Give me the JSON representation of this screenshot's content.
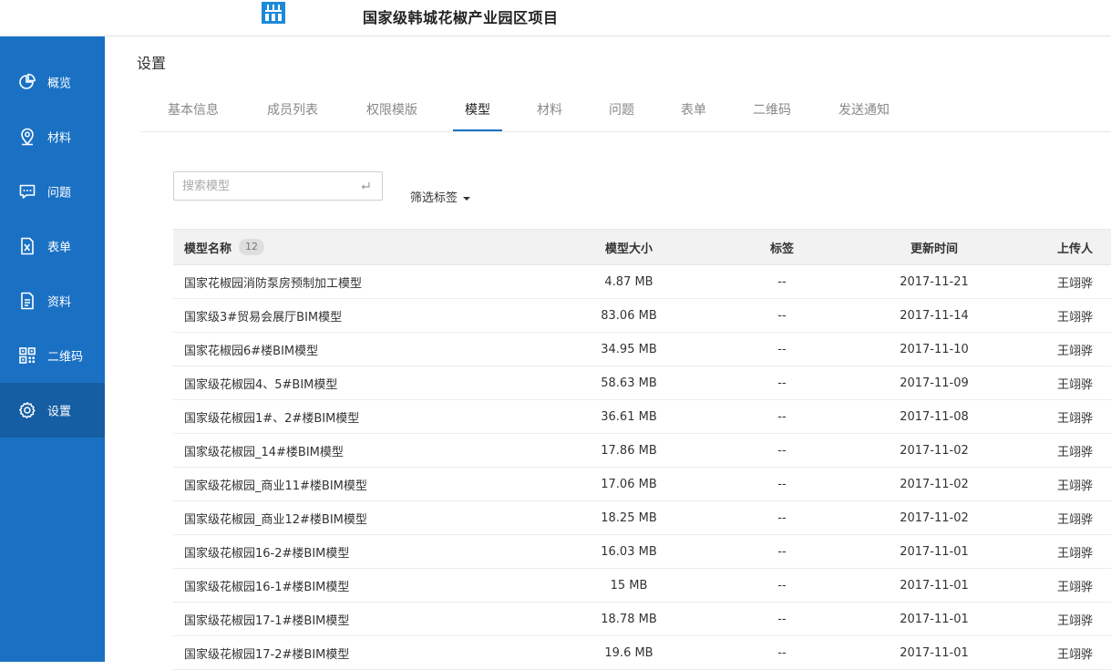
{
  "header": {
    "logo": "company-logo",
    "project_title": "国家级韩城花椒产业园区项目"
  },
  "sidebar": {
    "items": [
      {
        "label": "概览",
        "icon": "pie-chart-icon"
      },
      {
        "label": "材料",
        "icon": "location-pin-icon"
      },
      {
        "label": "问题",
        "icon": "chat-bubble-icon"
      },
      {
        "label": "表单",
        "icon": "excel-file-icon"
      },
      {
        "label": "资料",
        "icon": "document-icon"
      },
      {
        "label": "二维码",
        "icon": "qr-code-icon"
      },
      {
        "label": "设置",
        "icon": "gear-icon",
        "active": true
      }
    ],
    "colors": {
      "background": "#1a71c4",
      "active": "#165ea4"
    }
  },
  "main": {
    "title": "设置",
    "tabs": [
      {
        "label": "基本信息"
      },
      {
        "label": "成员列表"
      },
      {
        "label": "权限模版"
      },
      {
        "label": "模型",
        "active": true
      },
      {
        "label": "材料"
      },
      {
        "label": "问题"
      },
      {
        "label": "表单"
      },
      {
        "label": "二维码"
      },
      {
        "label": "发送通知"
      }
    ],
    "search": {
      "placeholder": "搜索模型",
      "value": ""
    },
    "filter_label": "筛选标签",
    "table": {
      "headers": {
        "name": "模型名称",
        "count": "12",
        "size": "模型大小",
        "tag": "标签",
        "time": "更新时间",
        "uploader": "上传人"
      },
      "rows": [
        {
          "name": "国家花椒园消防泵房预制加工模型",
          "size": "4.87 MB",
          "tag": "--",
          "time": "2017-11-21",
          "uploader": "王翊骅"
        },
        {
          "name": "国家级3#贸易会展厅BIM模型",
          "size": "83.06 MB",
          "tag": "--",
          "time": "2017-11-14",
          "uploader": "王翊骅"
        },
        {
          "name": "国家花椒园6#楼BIM模型",
          "size": "34.95 MB",
          "tag": "--",
          "time": "2017-11-10",
          "uploader": "王翊骅"
        },
        {
          "name": "国家级花椒园4、5#BIM模型",
          "size": "58.63 MB",
          "tag": "--",
          "time": "2017-11-09",
          "uploader": "王翊骅"
        },
        {
          "name": "国家级花椒园1#、2#楼BIM模型",
          "size": "36.61 MB",
          "tag": "--",
          "time": "2017-11-08",
          "uploader": "王翊骅"
        },
        {
          "name": "国家级花椒园_14#楼BIM模型",
          "size": "17.86 MB",
          "tag": "--",
          "time": "2017-11-02",
          "uploader": "王翊骅"
        },
        {
          "name": "国家级花椒园_商业11#楼BIM模型",
          "size": "17.06 MB",
          "tag": "--",
          "time": "2017-11-02",
          "uploader": "王翊骅"
        },
        {
          "name": "国家级花椒园_商业12#楼BIM模型",
          "size": "18.25 MB",
          "tag": "--",
          "time": "2017-11-02",
          "uploader": "王翊骅"
        },
        {
          "name": "国家级花椒园16-2#楼BIM模型",
          "size": "16.03 MB",
          "tag": "--",
          "time": "2017-11-01",
          "uploader": "王翊骅"
        },
        {
          "name": "国家级花椒园16-1#楼BIM模型",
          "size": "15 MB",
          "tag": "--",
          "time": "2017-11-01",
          "uploader": "王翊骅"
        },
        {
          "name": "国家级花椒园17-1#楼BIM模型",
          "size": "18.78 MB",
          "tag": "--",
          "time": "2017-11-01",
          "uploader": "王翊骅"
        },
        {
          "name": "国家级花椒园17-2#楼BIM模型",
          "size": "19.6 MB",
          "tag": "--",
          "time": "2017-11-01",
          "uploader": "王翊骅"
        }
      ]
    }
  }
}
